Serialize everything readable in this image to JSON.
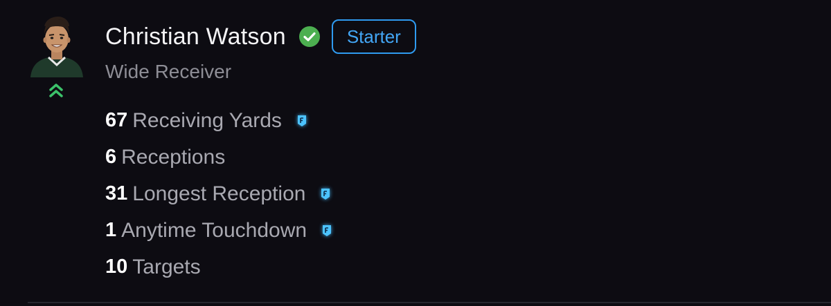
{
  "player": {
    "name": "Christian Watson",
    "badge": "Starter",
    "position": "Wide Receiver",
    "verified_icon": "check-circle-icon",
    "trend_icon": "double-chevron-up-icon"
  },
  "stats": [
    {
      "value": "67",
      "label": "Receiving Yards",
      "boost": true
    },
    {
      "value": "6",
      "label": "Receptions",
      "boost": false
    },
    {
      "value": "31",
      "label": "Longest Reception",
      "boost": true
    },
    {
      "value": "1",
      "label": "Anytime Touchdown",
      "boost": true
    },
    {
      "value": "10",
      "label": "Targets",
      "boost": false
    }
  ],
  "colors": {
    "background": "#0d0c12",
    "accent_blue": "#2f9bf0",
    "verified_green": "#4caf50",
    "trend_green": "#3cc26a",
    "jersey_green": "#1f3a2b",
    "boost_cyan": "#4cc3ff"
  }
}
